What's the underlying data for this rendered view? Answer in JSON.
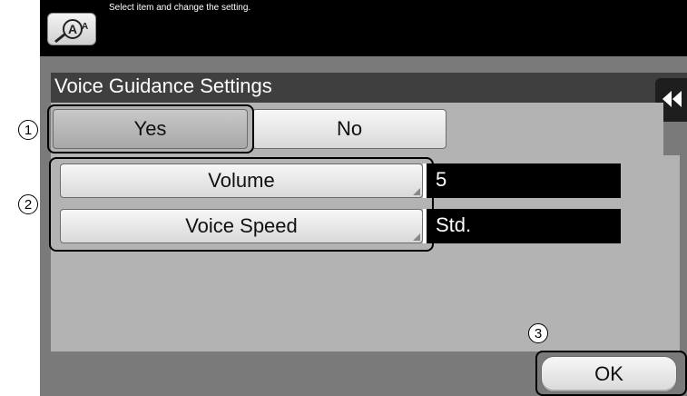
{
  "header": {
    "message": "Select item and change the setting.",
    "icon": "accessibility-icon"
  },
  "panel": {
    "title": "Voice Guidance Settings",
    "collapse_icon": "double-chevron-left-icon",
    "toggle": {
      "yes_label": "Yes",
      "no_label": "No",
      "selected": "Yes"
    },
    "settings": [
      {
        "label": "Volume",
        "value": "5"
      },
      {
        "label": "Voice Speed",
        "value": "Std."
      }
    ],
    "ok_label": "OK"
  },
  "callouts": [
    "1",
    "2",
    "3"
  ]
}
